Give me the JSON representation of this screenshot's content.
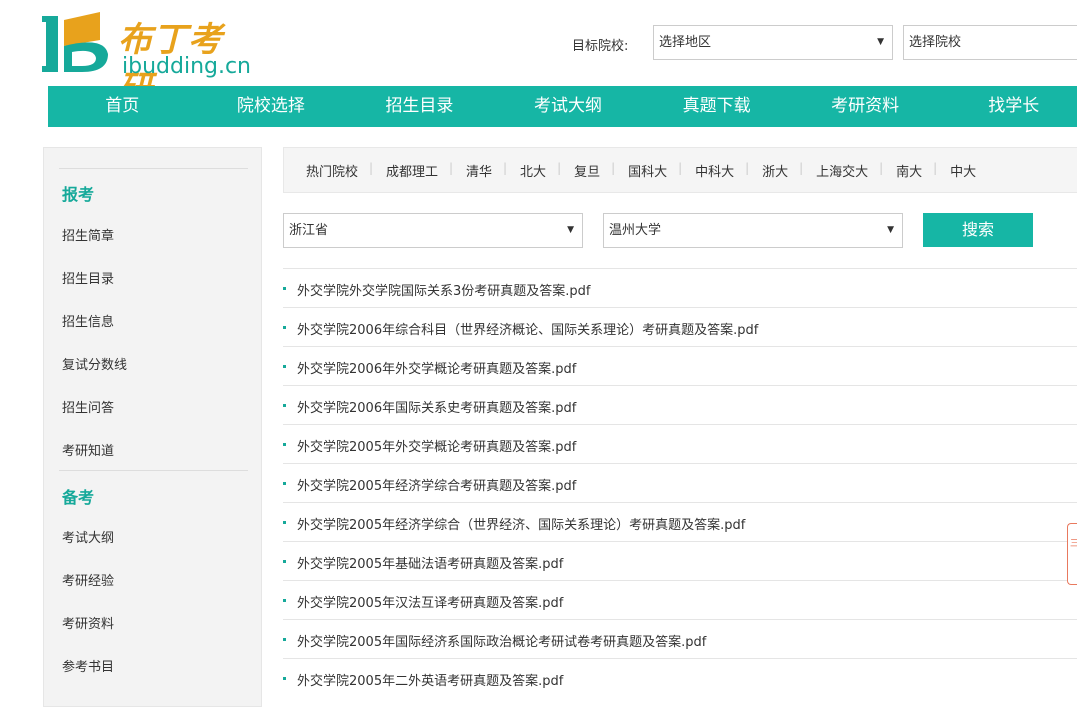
{
  "logo": {
    "cn": "布丁考研",
    "en": "ibudding.cn"
  },
  "header": {
    "target_label": "目标院校:",
    "region_select": "选择地区",
    "school_select": "选择院校"
  },
  "nav": [
    "首页",
    "院校选择",
    "招生目录",
    "考试大纲",
    "真题下载",
    "考研资料",
    "找学长"
  ],
  "sidebar": {
    "section1": {
      "title": "报考",
      "items": [
        "招生简章",
        "招生目录",
        "招生信息",
        "复试分数线",
        "招生问答",
        "考研知道"
      ]
    },
    "section2": {
      "title": "备考",
      "items": [
        "考试大纲",
        "考研经验",
        "考研资料",
        "参考书目"
      ]
    }
  },
  "tags": [
    "热门院校",
    "成都理工",
    "清华",
    "北大",
    "复旦",
    "国科大",
    "中科大",
    "浙大",
    "上海交大",
    "南大",
    "中大"
  ],
  "filters": {
    "province": "浙江省",
    "university": "温州大学",
    "search_label": "搜索"
  },
  "files": [
    "外交学院外交学院国际关系3份考研真题及答案.pdf",
    "外交学院2006年综合科目（世界经济概论、国际关系理论）考研真题及答案.pdf",
    "外交学院2006年外交学概论考研真题及答案.pdf",
    "外交学院2006年国际关系史考研真题及答案.pdf",
    "外交学院2005年外交学概论考研真题及答案.pdf",
    "外交学院2005年经济学综合考研真题及答案.pdf",
    "外交学院2005年经济学综合（世界经济、国际关系理论）考研真题及答案.pdf",
    "外交学院2005年基础法语考研真题及答案.pdf",
    "外交学院2005年汉法互译考研真题及答案.pdf",
    "外交学院2005年国际经济系国际政治概论考研试卷考研真题及答案.pdf",
    "外交学院2005年二外英语考研真题及答案.pdf"
  ],
  "float_tab": "三"
}
